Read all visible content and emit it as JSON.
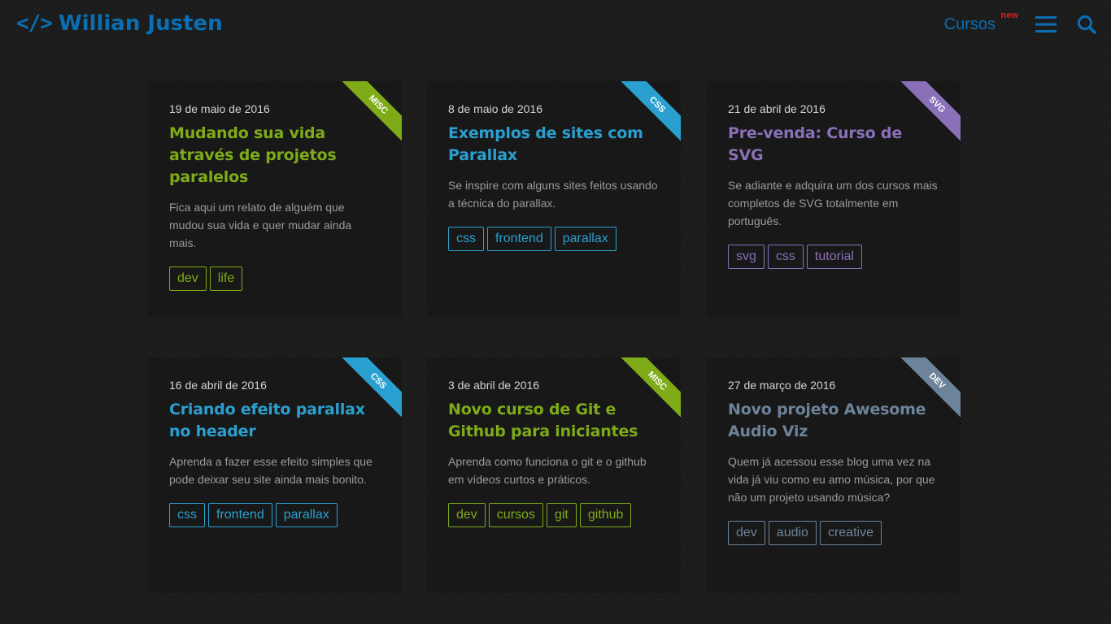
{
  "header": {
    "logo_code": "</>",
    "logo_name": "Willian Justen",
    "nav_cursos": "Cursos",
    "nav_new_badge": "new",
    "menu_icon": "hamburger-icon",
    "search_icon": "search-icon"
  },
  "colors": {
    "background": "#1d1d1d",
    "card_background": "#181818",
    "brand_blue": "#0a6eb4",
    "new_badge": "#d62424",
    "misc_green": "#7eab17",
    "css_blue": "#2aa0d0",
    "svg_purple": "#8a70b8",
    "dev_slate": "#6d8399"
  },
  "posts": [
    {
      "category": "MISC",
      "date": "19 de maio de 2016",
      "title": "Mudando sua vida através de projetos paralelos",
      "description": "Fica aqui um relato de alguém que mudou sua vida e quer mudar ainda mais.",
      "tags": [
        "dev",
        "life"
      ]
    },
    {
      "category": "CSS",
      "date": "8 de maio de 2016",
      "title": "Exemplos de sites com Parallax",
      "description": "Se inspire com alguns sites feitos usando a técnica do parallax.",
      "tags": [
        "css",
        "frontend",
        "parallax"
      ]
    },
    {
      "category": "SVG",
      "date": "21 de abril de 2016",
      "title": "Pre-venda: Curso de SVG",
      "description": "Se adiante e adquira um dos cursos mais completos de SVG totalmente em português.",
      "tags": [
        "svg",
        "css",
        "tutorial"
      ]
    },
    {
      "category": "CSS",
      "date": "16 de abril de 2016",
      "title": "Criando efeito parallax no header",
      "description": "Aprenda a fazer esse efeito simples que pode deixar seu site ainda mais bonito.",
      "tags": [
        "css",
        "frontend",
        "parallax"
      ]
    },
    {
      "category": "MISC",
      "date": "3 de abril de 2016",
      "title": "Novo curso de Git e Github para iniciantes",
      "description": "Aprenda como funciona o git e o github em vídeos curtos e práticos.",
      "tags": [
        "dev",
        "cursos",
        "git",
        "github"
      ]
    },
    {
      "category": "DEV",
      "date": "27 de março de 2016",
      "title": "Novo projeto Awesome Audio Viz",
      "description": "Quem já acessou esse blog uma vez na vida já viu como eu amo música, por que não um projeto usando música?",
      "tags": [
        "dev",
        "audio",
        "creative"
      ]
    }
  ]
}
